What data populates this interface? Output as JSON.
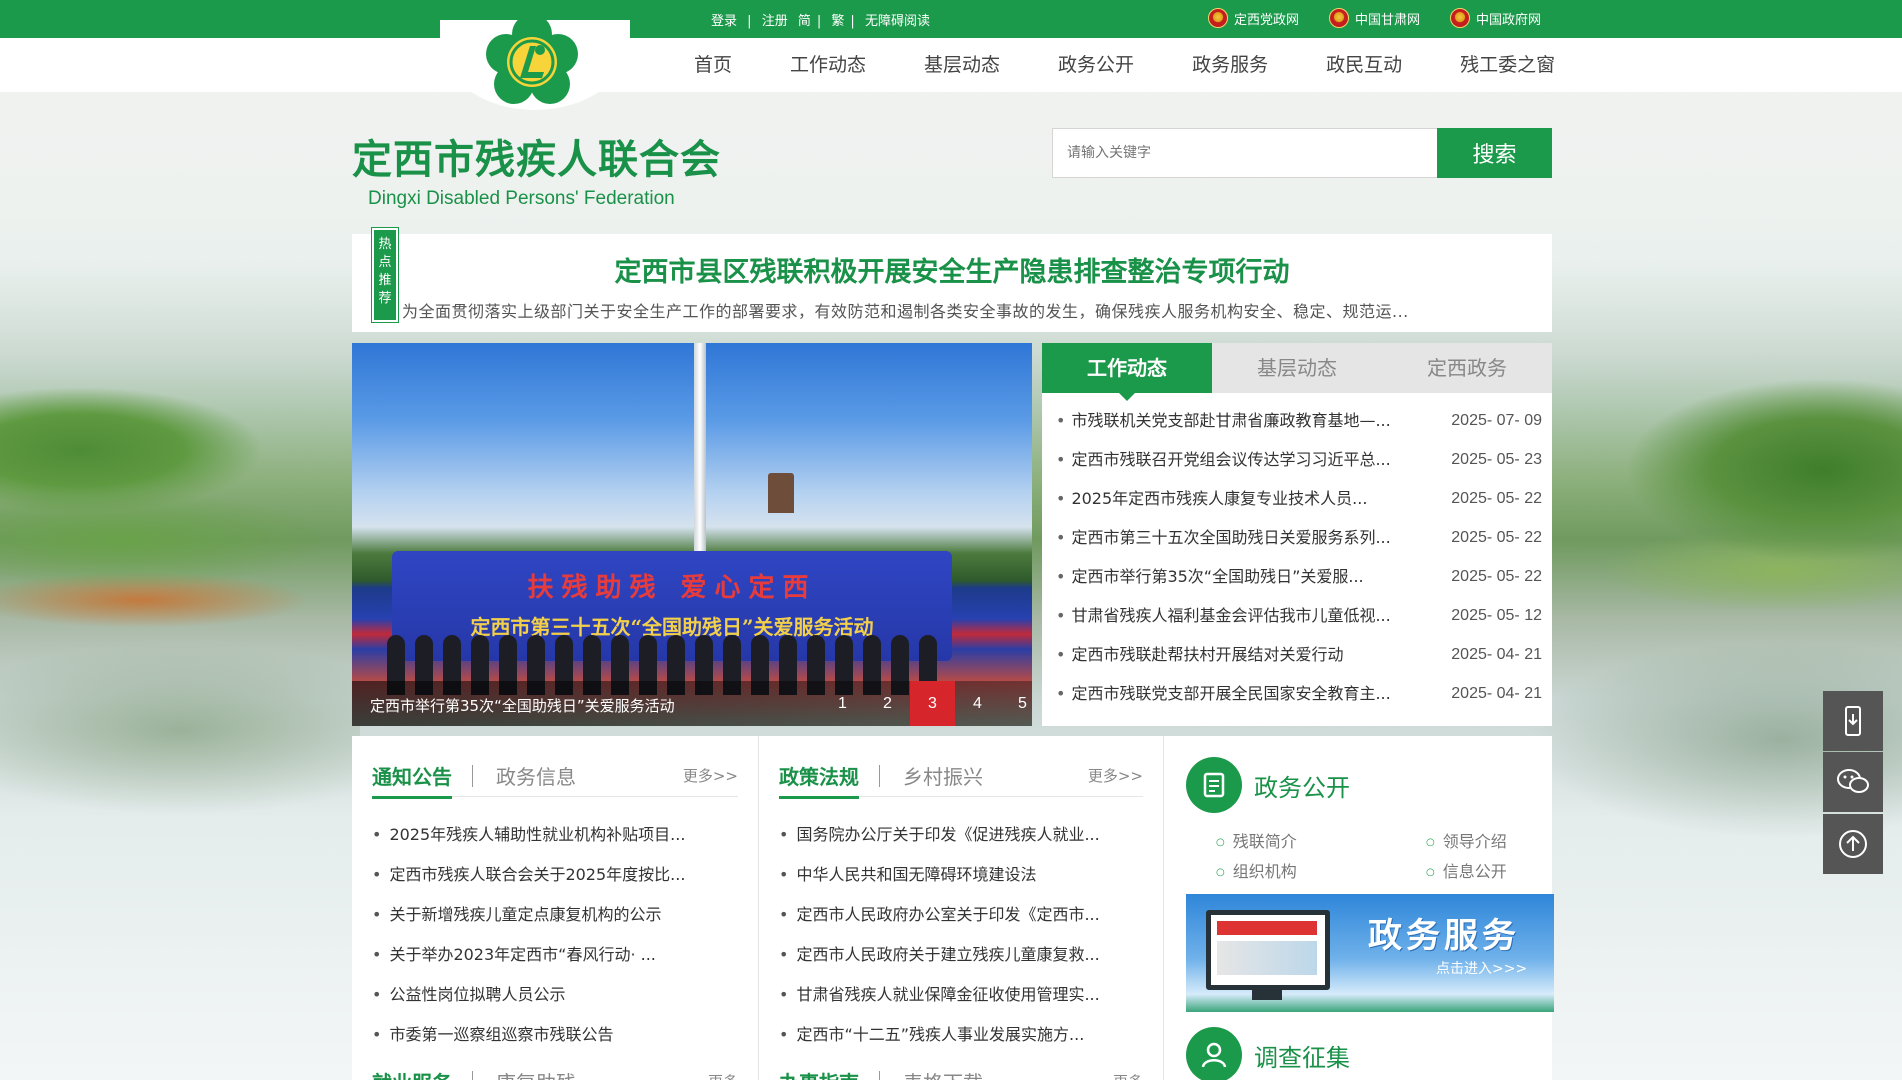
{
  "topbar": {
    "login": "登录",
    "sep1": "|",
    "register": "注册",
    "simplified": "简",
    "sep2": "|",
    "traditional": "繁",
    "sep3": "|",
    "accessible": "无障碍阅读",
    "sites": [
      {
        "label": "定西党政网",
        "icon": "national-emblem-icon"
      },
      {
        "label": "中国甘肃网",
        "icon": "national-emblem-icon"
      },
      {
        "label": "中国政府网",
        "icon": "national-emblem-icon"
      }
    ]
  },
  "nav": {
    "items": [
      "首页",
      "工作动态",
      "基层动态",
      "政务公开",
      "政务服务",
      "政民互动",
      "残工委之窗"
    ]
  },
  "header": {
    "title": "定西市残疾人联合会",
    "subtitle": "Dingxi Disabled Persons' Federation"
  },
  "search": {
    "placeholder": "请输入关键字",
    "button": "搜索"
  },
  "hot": {
    "tag": "热点推荐",
    "title": "定西市县区残联积极开展安全生产隐患排查整治专项行动",
    "summary": "为全面贯彻落实上级部门关于安全生产工作的部署要求，有效防范和遏制各类安全事故的发生，确保残疾人服务机构安全、稳定、规范运..."
  },
  "slider": {
    "banner_line1": "扶残助残 爱心定西",
    "banner_line2": "定西市第三十五次“全国助残日”关爱服务活动",
    "caption": "定西市举行第35次“全国助残日”关爱服务活动",
    "pages": [
      "1",
      "2",
      "3",
      "4",
      "5"
    ],
    "active_page": "3"
  },
  "news": {
    "tabs": [
      "工作动态",
      "基层动态",
      "定西政务"
    ],
    "active_tab": "工作动态",
    "items": [
      {
        "title": "市残联机关党支部赴甘肃省廉政教育基地—...",
        "date": "2025- 07- 09"
      },
      {
        "title": "定西市残联召开党组会议传达学习习近平总...",
        "date": "2025- 05- 23"
      },
      {
        "title": "2025年定西市残疾人康复专业技术人员...",
        "date": "2025- 05- 22"
      },
      {
        "title": "定西市第三十五次全国助残日关爱服务系列...",
        "date": "2025- 05- 22"
      },
      {
        "title": "定西市举行第35次“全国助残日”关爱服...",
        "date": "2025- 05- 22"
      },
      {
        "title": "甘肃省残疾人福利基金会评估我市儿童低视...",
        "date": "2025- 05- 12"
      },
      {
        "title": "定西市残联赴帮扶村开展结对关爱行动",
        "date": "2025- 04- 21"
      },
      {
        "title": "定西市残联党支部开展全民国家安全教育主...",
        "date": "2025- 04- 21"
      }
    ]
  },
  "notice": {
    "tab_active": "通知公告",
    "tab_other": "政务信息",
    "more": "更多>>",
    "items": [
      "2025年残疾人辅助性就业机构补贴项目...",
      "定西市残疾人联合会关于2025年度按比...",
      "关于新增残疾儿童定点康复机构的公示",
      "关于举办2023年定西市“春风行动· ...",
      "公益性岗位拟聘人员公示",
      "市委第一巡察组巡察市残联公告"
    ],
    "next_tab_active": "就业服务",
    "next_tab_other": "康复助残",
    "next_more": "更多"
  },
  "policy": {
    "tab_active": "政策法规",
    "tab_other": "乡村振兴",
    "more": "更多>>",
    "items": [
      "国务院办公厅关于印发《促进残疾人就业...",
      "中华人民共和国无障碍环境建设法",
      "定西市人民政府办公室关于印发《定西市...",
      "定西市人民政府关于建立残疾儿童康复救...",
      "甘肃省残疾人就业保障金征收使用管理实...",
      "定西市“十二五”残疾人事业发展实施方..."
    ],
    "next_tab_active": "办事指南",
    "next_tab_other": "表格下载",
    "next_more": "更多"
  },
  "gov": {
    "title": "政务公开",
    "links": [
      "残联简介",
      "领导介绍",
      "组织机构",
      "信息公开"
    ],
    "service_banner_title": "政务服务",
    "service_banner_sub": "点击进入>>>",
    "survey_title": "调查征集"
  },
  "float_buttons": [
    "mobile-icon",
    "wechat-icon",
    "back-to-top-icon"
  ],
  "colors": {
    "primary": "#1c9a4b",
    "active_dot": "#d7262b"
  }
}
